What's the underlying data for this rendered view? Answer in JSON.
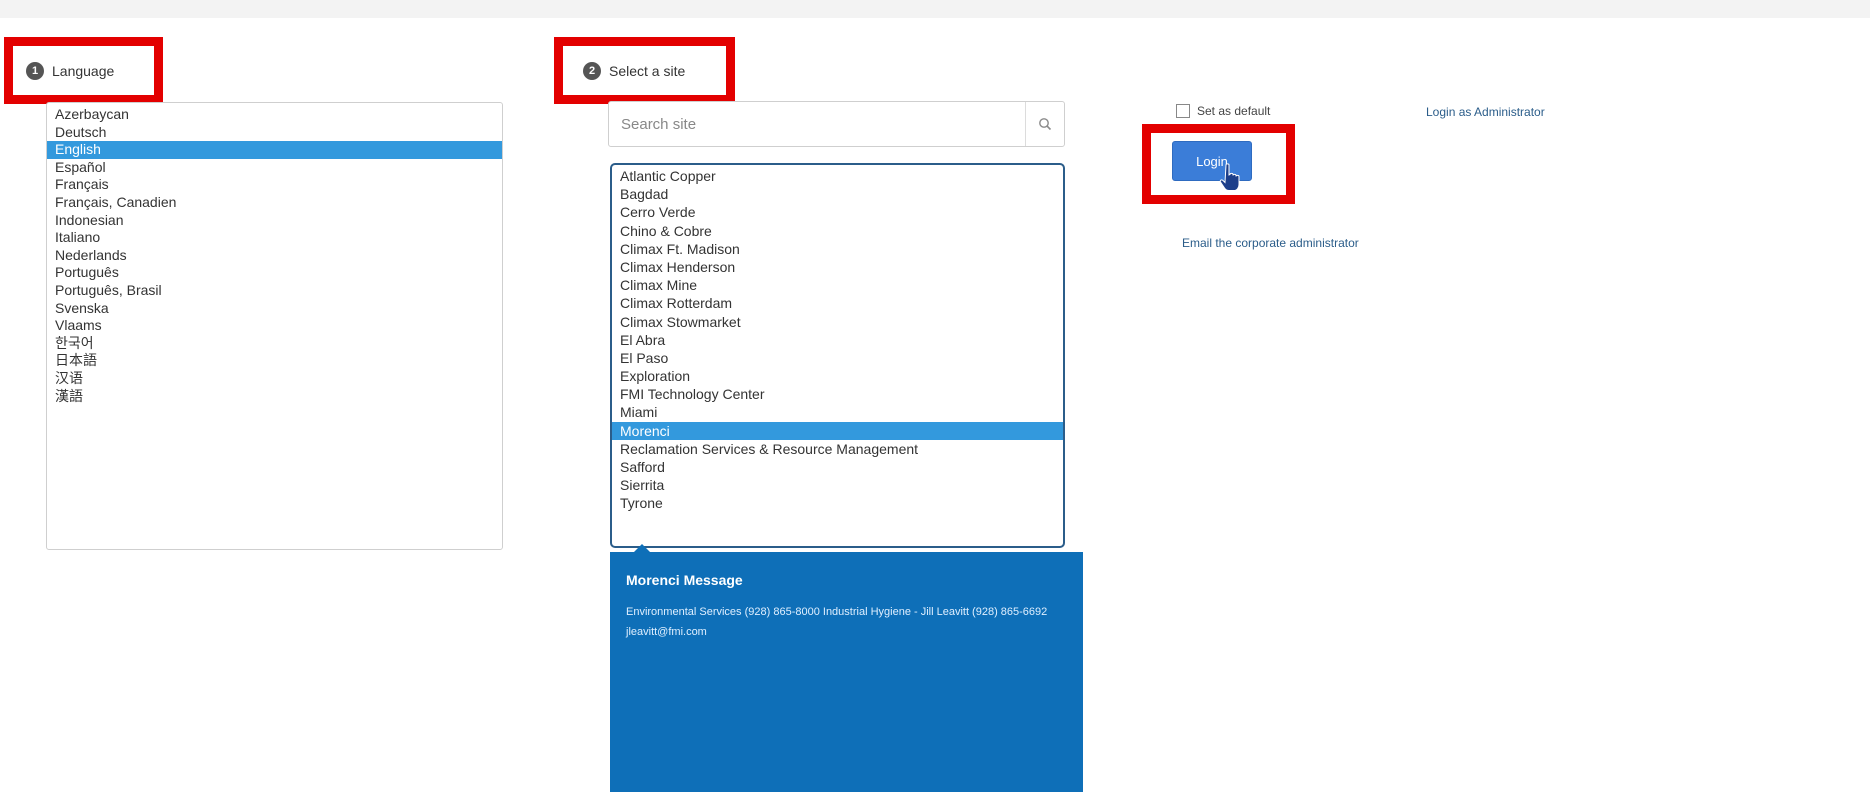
{
  "language": {
    "step_number": "1",
    "title": "Language",
    "items": [
      "Azerbaycan",
      "Deutsch",
      "English",
      "Español",
      "Français",
      "Français, Canadien",
      "Indonesian",
      "Italiano",
      "Nederlands",
      "Português",
      "Português, Brasil",
      "Svenska",
      "Vlaams",
      "한국어",
      "日本語",
      "汉语",
      "漢語"
    ],
    "selected": "English"
  },
  "site": {
    "step_number": "2",
    "title": "Select a site",
    "search_placeholder": "Search site",
    "search_icon": "search-icon",
    "items": [
      "Atlantic Copper",
      "Bagdad",
      "Cerro Verde",
      "Chino & Cobre",
      "Climax Ft. Madison",
      "Climax Henderson",
      "Climax Mine",
      "Climax Rotterdam",
      "Climax Stowmarket",
      "El Abra",
      "El Paso",
      "Exploration",
      "FMI Technology Center",
      "Miami",
      "Morenci",
      "Reclamation Services & Resource Management",
      "Safford",
      "Sierrita",
      "Tyrone"
    ],
    "selected": "Morenci"
  },
  "message": {
    "title": "Morenci Message",
    "body": "Environmental Services (928) 865-8000 Industrial Hygiene - Jill Leavitt (928) 865-6692 jleavitt@fmi.com"
  },
  "auth": {
    "set_default_label": "Set as default",
    "admin_login_label": "Login as Administrator",
    "login_label": "Login",
    "email_admin_label": "Email the corporate administrator"
  },
  "colors": {
    "selection": "#3399dd",
    "message_panel": "#0e6fb8",
    "login_button": "#3b7dd8",
    "highlight_box": "#e30000"
  }
}
